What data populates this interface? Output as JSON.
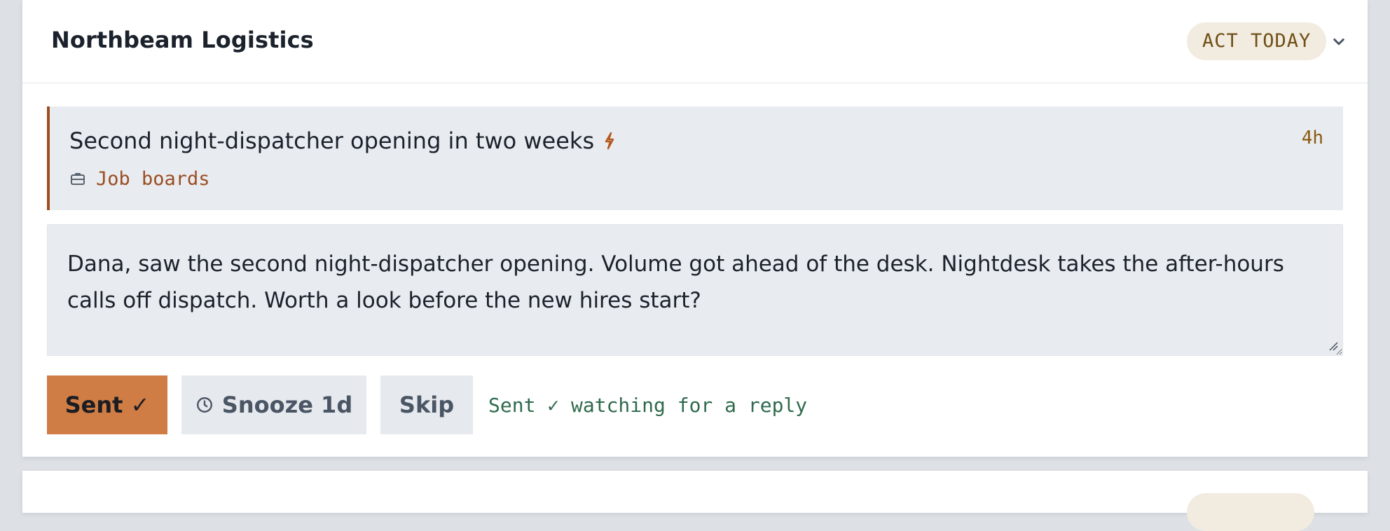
{
  "card": {
    "company": "Northbeam Logistics",
    "badge": "ACT TODAY",
    "signal": {
      "title": "Second night-dispatcher opening in two weeks",
      "source": "Job boards",
      "age": "4h"
    },
    "draft": "Dana, saw the second night-dispatcher opening. Volume got ahead of the desk. Nightdesk takes the after-hours calls off dispatch. Worth a look before the new hires start?",
    "actions": {
      "sent_label": "Sent ✓",
      "snooze_label": "Snooze 1d",
      "skip_label": "Skip"
    },
    "status": "Sent ✓ watching for a reply"
  },
  "colors": {
    "accent": "#d07c45",
    "signal_border": "#9b4e22",
    "badge_bg": "#f2ece0",
    "status_green": "#2f6b4c"
  },
  "icons": [
    "chevron-down-icon",
    "lightning-icon",
    "briefcase-icon",
    "clock-icon",
    "resize-grip-icon"
  ]
}
